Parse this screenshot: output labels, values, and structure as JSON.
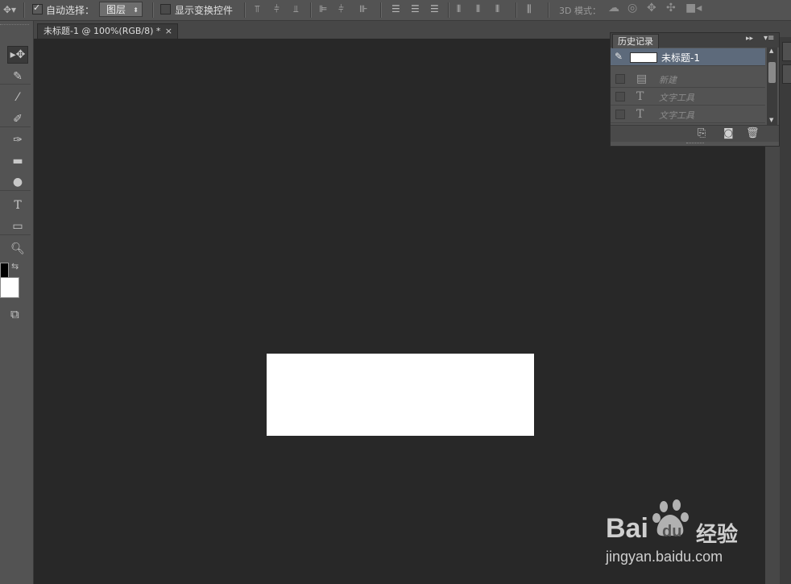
{
  "options_bar": {
    "auto_select_label": "自动选择：",
    "auto_select_checked": true,
    "layer_select_value": "图层",
    "show_transform_label": "显示变换控件",
    "show_transform_checked": false,
    "mode_3d_label": "3D 模式："
  },
  "document_tab": {
    "title": "未标题-1 @ 100%(RGB/8) *",
    "close_glyph": "×"
  },
  "tools": [
    {
      "name": "move-tool",
      "glyph": "▸✥",
      "active": true
    },
    {
      "name": "quick-selection-tool",
      "glyph": "✎",
      "active": false
    },
    {
      "name": "eyedropper-tool",
      "glyph": "⁄",
      "active": false
    },
    {
      "name": "brush-tool",
      "glyph": "✐",
      "active": false
    },
    {
      "name": "history-brush-tool",
      "glyph": "✑",
      "active": false
    },
    {
      "name": "gradient-tool",
      "glyph": "▬",
      "active": false
    },
    {
      "name": "dodge-tool",
      "glyph": "●",
      "active": false
    },
    {
      "name": "type-tool",
      "glyph": "T",
      "active": false
    },
    {
      "name": "rectangle-tool",
      "glyph": "▭",
      "active": false
    },
    {
      "name": "zoom-tool",
      "glyph": "🔍︎",
      "active": false
    },
    {
      "name": "quick-mask-tool",
      "glyph": "⧉",
      "active": false
    }
  ],
  "colors": {
    "foreground": "#000000",
    "background": "#ffffff",
    "canvas_fill": "#ffffff",
    "workspace": "#282828",
    "history_selected": "#5d6a7b"
  },
  "history_panel": {
    "tab_label": "历史记录",
    "snapshot_label": "未标题-1",
    "entries": [
      {
        "label": "新建",
        "icon": "document-icon"
      },
      {
        "label": "文字工具",
        "icon": "type-icon"
      },
      {
        "label": "文字工具",
        "icon": "type-icon"
      }
    ],
    "footer_icons": [
      "new-document-from-state-icon",
      "camera-icon",
      "trash-icon"
    ]
  },
  "watermark": {
    "brand": "Bai",
    "brand_suffix": "du",
    "product": "经验",
    "url": "jingyan.baidu.com"
  }
}
